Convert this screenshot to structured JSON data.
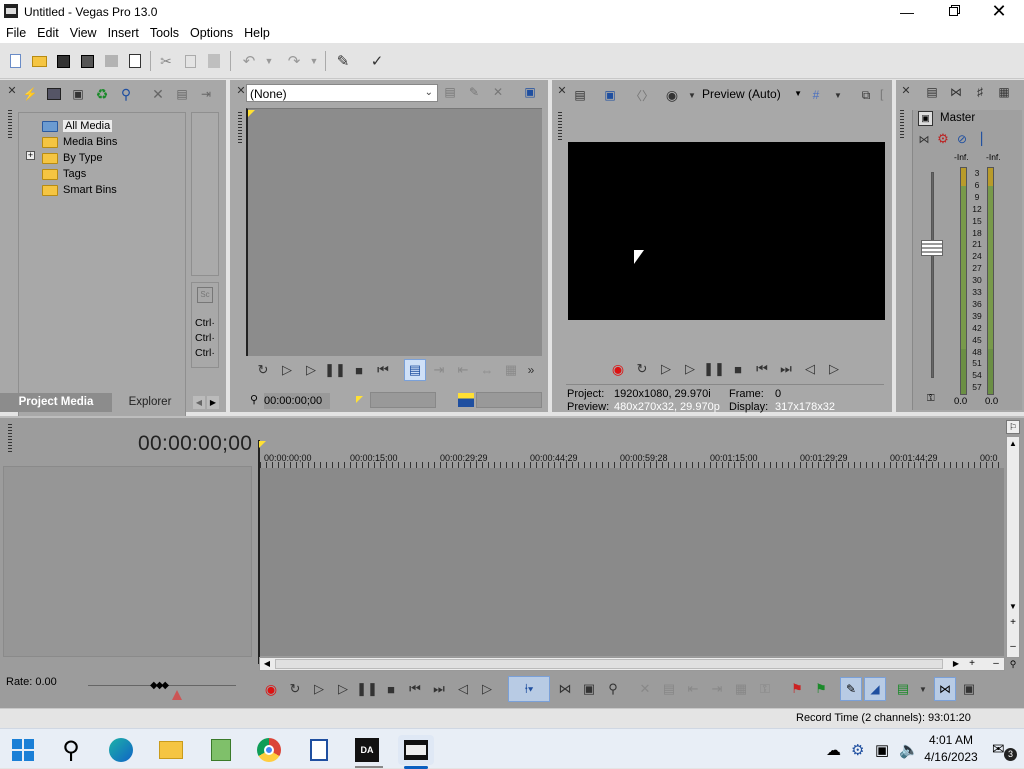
{
  "window": {
    "title": "Untitled - Vegas Pro 13.0",
    "app_icon": "vegas-film-icon"
  },
  "menu": [
    "File",
    "Edit",
    "View",
    "Insert",
    "Tools",
    "Options",
    "Help"
  ],
  "project_media": {
    "tree": [
      "All Media",
      "Media Bins",
      "By Type",
      "Tags",
      "Smart Bins"
    ],
    "tabs": [
      "Project Media",
      "Explorer"
    ],
    "shortcuts": [
      "Ctrl·",
      "Ctrl·",
      "Ctrl·"
    ]
  },
  "trimmer": {
    "dropdown_value": "(None)",
    "timecode": "00:00:00;00"
  },
  "preview": {
    "mode_label": "Preview (Auto)",
    "project_label": "Project:",
    "project_value": "1920x1080, 29.970i",
    "frame_label": "Frame:",
    "frame_value": "0",
    "preview_label": "Preview:",
    "preview_value": "480x270x32, 29.970p",
    "display_label": "Display:",
    "display_value": "317x178x32"
  },
  "mixer": {
    "master_label": "Master",
    "left_peak": "-Inf.",
    "right_peak": "-Inf.",
    "left_level": "0.0",
    "right_level": "0.0",
    "scale": [
      "3",
      "6",
      "9",
      "12",
      "15",
      "18",
      "21",
      "24",
      "27",
      "30",
      "33",
      "36",
      "39",
      "42",
      "45",
      "48",
      "51",
      "54",
      "57"
    ]
  },
  "timeline": {
    "timecode": "00:00:00;00",
    "ruler": [
      "00:00:00;00",
      "00:00:15;00",
      "00:00:29;29",
      "00:00:44;29",
      "00:00:59;28",
      "00:01:15;00",
      "00:01:29;29",
      "00:01:44;29",
      "00:0"
    ],
    "rate": "Rate: 0.00"
  },
  "status": {
    "record_time": "Record Time (2 channels): 93:01:20"
  },
  "taskbar": {
    "time": "4:01 AM",
    "date": "4/16/2023",
    "notifications": "3"
  }
}
